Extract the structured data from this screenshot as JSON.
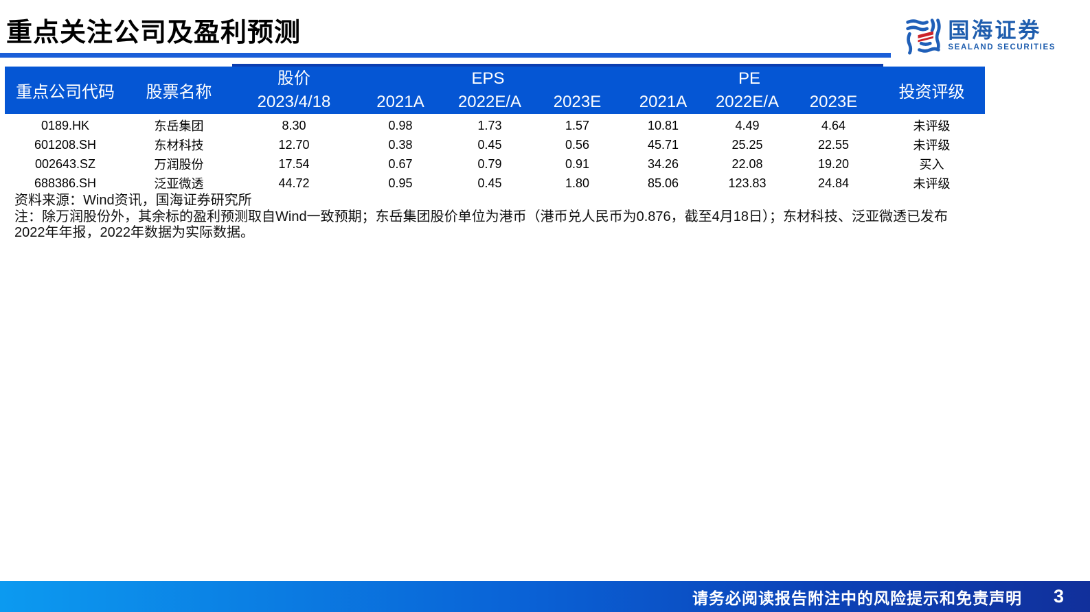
{
  "page": {
    "title": "重点关注公司及盈利预测"
  },
  "logo": {
    "name": "国海证券",
    "subtitle": "SEALAND SECURITIES"
  },
  "table": {
    "headers": {
      "company_code": "重点公司代码",
      "stock_name": "股票名称",
      "price_group": "股价",
      "price_date": "2023/4/18",
      "eps_group": "EPS",
      "pe_group": "PE",
      "eps_cols": [
        "2021A",
        "2022E/A",
        "2023E"
      ],
      "pe_cols": [
        "2021A",
        "2022E/A",
        "2023E"
      ],
      "rating": "投资评级"
    },
    "rows": [
      {
        "code": "0189.HK",
        "name": "东岳集团",
        "price": "8.30",
        "eps_2021": "0.98",
        "eps_2022": "1.73",
        "eps_2023": "1.57",
        "pe_2021": "10.81",
        "pe_2022": "4.49",
        "pe_2023": "4.64",
        "rating": "未评级"
      },
      {
        "code": "601208.SH",
        "name": "东材科技",
        "price": "12.70",
        "eps_2021": "0.38",
        "eps_2022": "0.45",
        "eps_2023": "0.56",
        "pe_2021": "45.71",
        "pe_2022": "25.25",
        "pe_2023": "22.55",
        "rating": "未评级"
      },
      {
        "code": "002643.SZ",
        "name": "万润股份",
        "price": "17.54",
        "eps_2021": "0.67",
        "eps_2022": "0.79",
        "eps_2023": "0.91",
        "pe_2021": "34.26",
        "pe_2022": "22.08",
        "pe_2023": "19.20",
        "rating": "买入"
      },
      {
        "code": "688386.SH",
        "name": "泛亚微透",
        "price": "44.72",
        "eps_2021": "0.95",
        "eps_2022": "0.45",
        "eps_2023": "1.80",
        "pe_2021": "85.06",
        "pe_2022": "123.83",
        "pe_2023": "24.84",
        "rating": "未评级"
      }
    ]
  },
  "notes": {
    "source": "资料来源：Wind资讯，国海证券研究所",
    "note": "注：除万润股份外，其余标的盈利预测取自Wind一致预期；东岳集团股价单位为港币（港币兑人民币为0.876，截至4月18日）；东材科技、泛亚微透已发布2022年年报，2022年数据为实际数据。"
  },
  "footer": {
    "disclaimer": "请务必阅读报告附注中的风险提示和免责声明",
    "page_number": "3"
  },
  "colors": {
    "header_blue": "#0556D4",
    "accent_strip_blue": "#0B3EB0",
    "title_underline_blue": "#1A5ED8",
    "footer_gradient_left": "#0C9AF0",
    "footer_gradient_right": "#11309B",
    "logo_blue": "#1E5DAE",
    "logo_red": "#CC2229"
  }
}
